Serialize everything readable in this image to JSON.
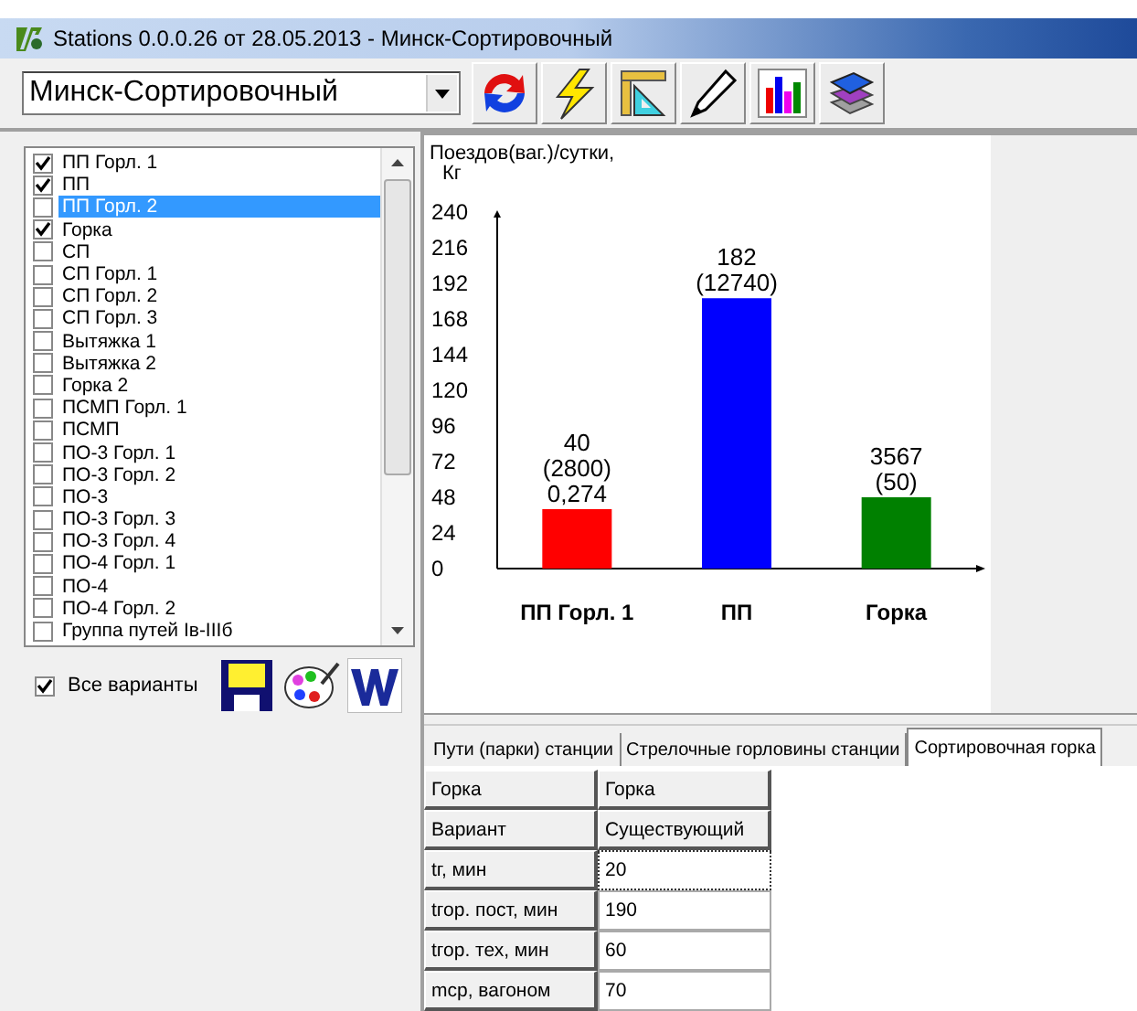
{
  "window": {
    "title": "Stations 0.0.0.26 от 28.05.2013 - Минск-Сортировочный"
  },
  "toolbar": {
    "station_select": {
      "value": "Минск-Сортировочный"
    }
  },
  "variants": {
    "items": [
      {
        "label": "ПП Горл. 1",
        "checked": true,
        "selected": false
      },
      {
        "label": "ПП",
        "checked": true,
        "selected": false
      },
      {
        "label": "ПП Горл. 2",
        "checked": false,
        "selected": true
      },
      {
        "label": "Горка",
        "checked": true,
        "selected": false
      },
      {
        "label": "СП",
        "checked": false,
        "selected": false
      },
      {
        "label": "СП Горл. 1",
        "checked": false,
        "selected": false
      },
      {
        "label": "СП Горл. 2",
        "checked": false,
        "selected": false
      },
      {
        "label": "СП Горл. 3",
        "checked": false,
        "selected": false
      },
      {
        "label": "Вытяжка 1",
        "checked": false,
        "selected": false
      },
      {
        "label": "Вытяжка 2",
        "checked": false,
        "selected": false
      },
      {
        "label": "Горка 2",
        "checked": false,
        "selected": false
      },
      {
        "label": "ПСМП Горл. 1",
        "checked": false,
        "selected": false
      },
      {
        "label": "ПСМП",
        "checked": false,
        "selected": false
      },
      {
        "label": "ПО-3 Горл. 1",
        "checked": false,
        "selected": false
      },
      {
        "label": "ПО-3 Горл. 2",
        "checked": false,
        "selected": false
      },
      {
        "label": "ПО-3",
        "checked": false,
        "selected": false
      },
      {
        "label": "ПО-3 Горл. 3",
        "checked": false,
        "selected": false
      },
      {
        "label": "ПО-3 Горл. 4",
        "checked": false,
        "selected": false
      },
      {
        "label": "ПО-4 Горл. 1",
        "checked": false,
        "selected": false
      },
      {
        "label": "ПО-4",
        "checked": false,
        "selected": false
      },
      {
        "label": "ПО-4 Горл. 2",
        "checked": false,
        "selected": false
      },
      {
        "label": "Группа путей Iв-IIIб",
        "checked": false,
        "selected": false
      }
    ],
    "all_variants": {
      "label": "Все варианты",
      "checked": true
    }
  },
  "chart": {
    "chart_data": {
      "type": "bar",
      "ylabel": "Поездов(ваг.)/сутки,",
      "annotations": [
        {
          "text": "Кг"
        }
      ],
      "categories": [
        "ПП Горл. 1",
        "ПП",
        "Горка"
      ],
      "series": [
        {
          "color": "#ff0000",
          "values": [
            40,
            null,
            null
          ]
        },
        {
          "color": "#0000ff",
          "values": [
            null,
            182,
            null
          ]
        },
        {
          "color": "#008000",
          "values": [
            null,
            null,
            48
          ]
        }
      ],
      "ylim": [
        0,
        240
      ],
      "yticks": [
        0,
        24,
        48,
        72,
        96,
        120,
        144,
        168,
        192,
        216,
        240
      ],
      "value_labels": [
        [
          "40",
          "(2800)",
          "0,274"
        ],
        [
          "182",
          "(12740)"
        ],
        [
          "3567",
          "(50)"
        ]
      ]
    }
  },
  "tabs": [
    {
      "label": "Пути (парки) станции",
      "selected": false
    },
    {
      "label": "Стрелочные горловины станции",
      "selected": false
    },
    {
      "label": "Сортировочная горка",
      "selected": true
    }
  ],
  "table": {
    "rows": [
      {
        "kind": "header",
        "name": "Горка",
        "value": "Горка"
      },
      {
        "kind": "header",
        "name": "Вариант",
        "value": "Существующий"
      },
      {
        "kind": "input",
        "name": "tг, мин",
        "value": "20",
        "focused": true
      },
      {
        "kind": "input",
        "name": "tгор. пост, мин",
        "value": "190",
        "focused": false
      },
      {
        "kind": "input",
        "name": "tгор. тех, мин",
        "value": "60",
        "focused": false
      },
      {
        "kind": "input",
        "name": "mср, вагоном",
        "value": "70",
        "focused": false
      }
    ]
  }
}
